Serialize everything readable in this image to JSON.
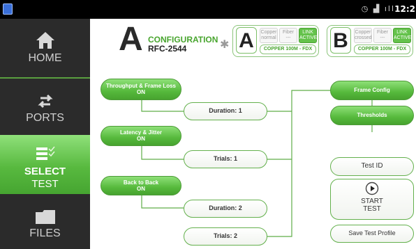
{
  "status_bar": {
    "clock": "12:2",
    "icons": [
      "clock-icon",
      "signal-icon",
      "wifi-bars-icon"
    ]
  },
  "sidebar": {
    "items": [
      {
        "label": "HOME",
        "icon": "home-icon",
        "active": false
      },
      {
        "label": "PORTS",
        "icon": "ports-icon",
        "active": false
      },
      {
        "label_line1": "SELECT",
        "label_line2": "TEST",
        "icon": "checklist-icon",
        "active": true
      },
      {
        "label": "FILES",
        "icon": "folder-icon",
        "active": false
      }
    ]
  },
  "header": {
    "logo_letter": "A",
    "title": "CONFIGURATION",
    "subtitle": "RFC-2544",
    "bluetooth_icon": "bluetooth-icon"
  },
  "ports": [
    {
      "letter": "A",
      "cells": [
        {
          "line1": "Copper",
          "line2": "normal",
          "live": false
        },
        {
          "line1": "Fiber",
          "line2": "---",
          "live": false
        },
        {
          "line1": "LINK",
          "line2": "ACTIVE",
          "live": true
        }
      ],
      "link": "COPPER 100M - FDX"
    },
    {
      "letter": "B",
      "cells": [
        {
          "line1": "Copper",
          "line2": "crossed",
          "live": false
        },
        {
          "line1": "Fiber",
          "line2": "---",
          "live": false
        },
        {
          "line1": "LINK",
          "line2": "ACTIVE",
          "live": true
        }
      ],
      "link": "COPPER 100M - FDX"
    }
  ],
  "tests": [
    {
      "name": "Throughput & Frame Loss",
      "state": "ON",
      "param": "Duration:  1"
    },
    {
      "name": "Latency & Jitter",
      "state": "ON",
      "param": "Trials:  1"
    },
    {
      "name": "Back to Back",
      "state": "ON",
      "param": "Duration:  2",
      "param2": "Trials:  2"
    }
  ],
  "right_panel": {
    "frame_config": "Frame Config",
    "thresholds": "Thresholds",
    "test_id": "Test ID",
    "start_line1": "START",
    "start_line2": "TEST",
    "start_icon": "play-icon",
    "save_profile": "Save Test Profile"
  },
  "colors": {
    "accent_green": "#56b93c",
    "sidebar_bg": "#2b2b2b",
    "status_bar_bg": "#000000"
  }
}
